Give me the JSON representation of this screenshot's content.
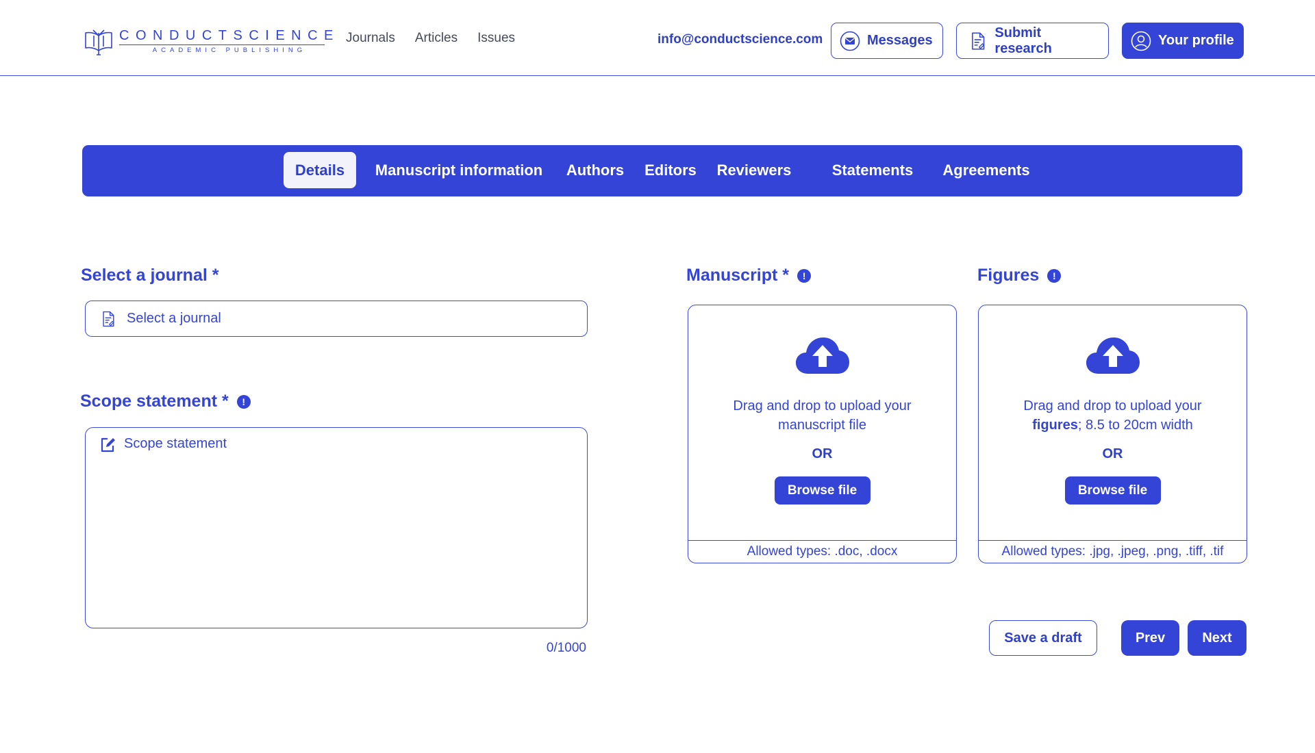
{
  "brand": {
    "name": "CONDUCTSCIENCE",
    "sub": "ACADEMIC PUBLISHING"
  },
  "nav": {
    "journals": "Journals",
    "articles": "Articles",
    "issues": "Issues"
  },
  "header": {
    "email": "info@conductscience.com",
    "messages_label": "Messages",
    "submit_label": "Submit research",
    "profile_label": "Your profile"
  },
  "tabs": [
    {
      "label": "Details",
      "active": true
    },
    {
      "label": "Manuscript information",
      "active": false
    },
    {
      "label": "Authors",
      "active": false
    },
    {
      "label": "Editors",
      "active": false
    },
    {
      "label": "Reviewers",
      "active": false
    },
    {
      "label": "Statements",
      "active": false
    },
    {
      "label": "Agreements",
      "active": false
    }
  ],
  "journal": {
    "label": "Select a journal *",
    "placeholder": "Select a journal"
  },
  "scope": {
    "label": "Scope statement *",
    "placeholder": "Scope statement",
    "counter": "0/1000"
  },
  "manuscript": {
    "label": "Manuscript *",
    "drop_text": "Drag and drop to upload your manuscript file",
    "or": "OR",
    "browse": "Browse file",
    "allowed": "Allowed types: .doc, .docx"
  },
  "figures": {
    "label": "Figures",
    "drop_pre": "Drag and drop to upload your",
    "drop_bold": "figures",
    "drop_post": "; 8.5 to 20cm width",
    "or": "OR",
    "browse": "Browse file",
    "allowed": "Allowed types: .jpg, .jpeg, .png, .tiff, .tif"
  },
  "actions": {
    "draft": "Save a draft",
    "prev": "Prev",
    "next": "Next"
  },
  "colors": {
    "accent": "#3344d6",
    "tab_active_bg": "#f2f3fa"
  },
  "icons": {
    "logo": "book-logo-icon",
    "messages": "envelope-icon",
    "submit": "document-icon",
    "profile": "user-icon",
    "journal_field": "document-icon",
    "scope_field": "edit-icon",
    "info": "info-icon",
    "upload": "cloud-upload-icon"
  }
}
